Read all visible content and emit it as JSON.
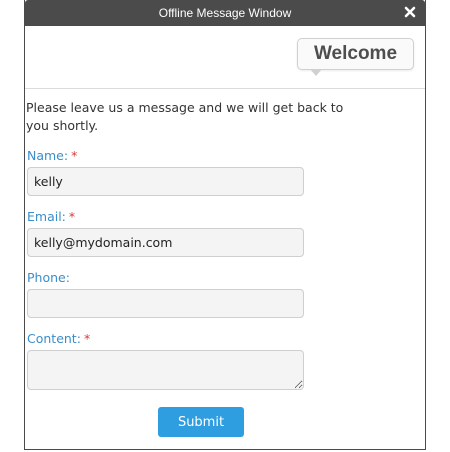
{
  "window": {
    "title": "Offline Message Window",
    "close_icon": "close-icon",
    "welcome_text": "Welcome"
  },
  "form": {
    "intro": "Please leave us a message and we will get back to you shortly.",
    "fields": [
      {
        "label": "Name:",
        "required": true,
        "value": "kelly",
        "placeholder": ""
      },
      {
        "label": "Email:",
        "required": true,
        "value": "kelly@mydomain.com",
        "placeholder": ""
      },
      {
        "label": "Phone:",
        "required": false,
        "value": "",
        "placeholder": ""
      },
      {
        "label": "Content:",
        "required": true,
        "value": "",
        "placeholder": ""
      }
    ],
    "required_marker": "*",
    "submit_label": "Submit"
  },
  "colors": {
    "titlebar": "#4b4b4b",
    "label": "#3a8ec9",
    "required": "#d83a3a",
    "submit": "#2f9ee0"
  }
}
